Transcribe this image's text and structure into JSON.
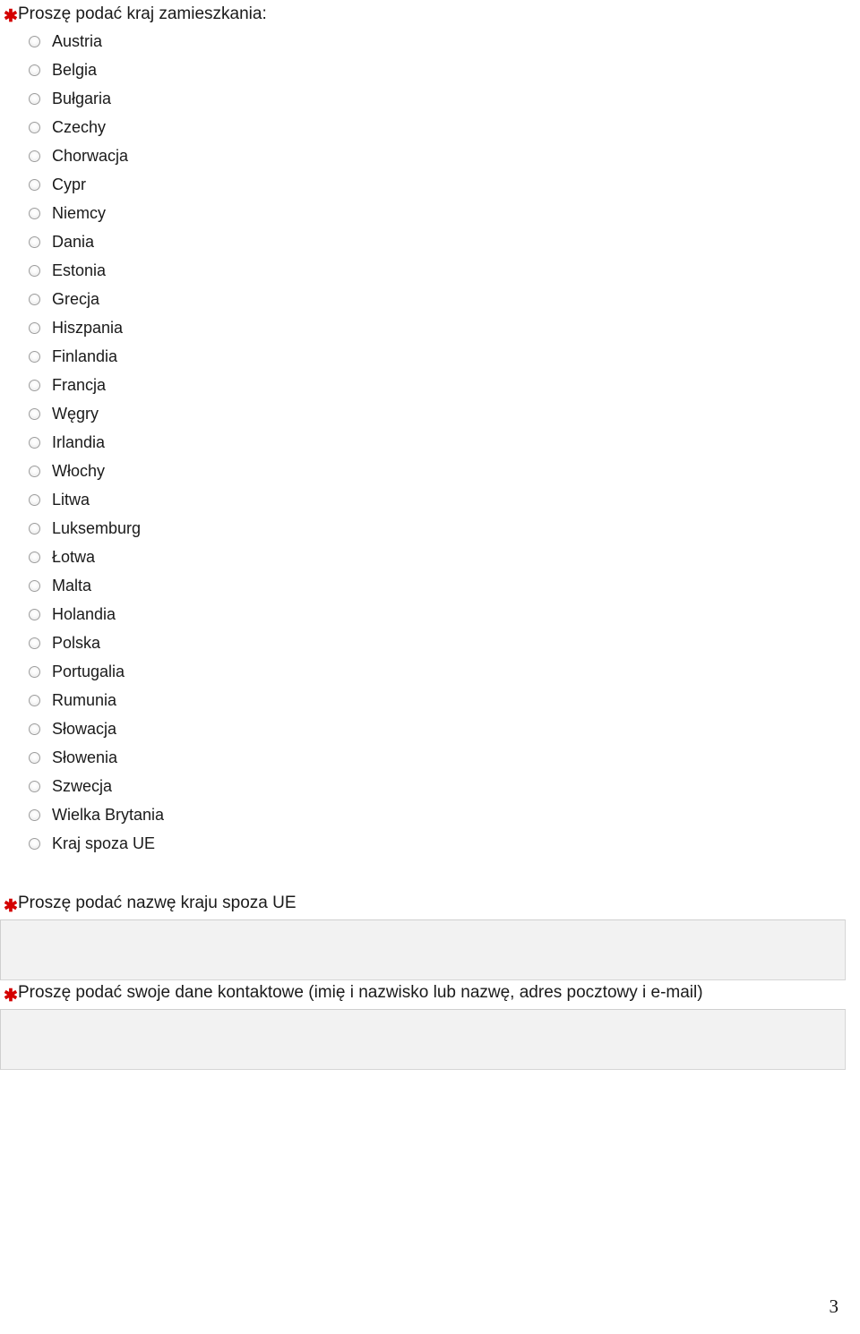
{
  "page": {
    "number": "3",
    "required_marker": "✱",
    "accent_required_color": "#d40000",
    "input_fill_color": "#f2f2f2",
    "input_border_color": "#d6d6d6"
  },
  "country_question": {
    "label": "Proszę podać kraj zamieszkania:",
    "required": true,
    "options": [
      {
        "label": "Austria",
        "selected": false
      },
      {
        "label": "Belgia",
        "selected": false
      },
      {
        "label": "Bułgaria",
        "selected": false
      },
      {
        "label": "Czechy",
        "selected": false
      },
      {
        "label": "Chorwacja",
        "selected": false
      },
      {
        "label": "Cypr",
        "selected": false
      },
      {
        "label": "Niemcy",
        "selected": false
      },
      {
        "label": "Dania",
        "selected": false
      },
      {
        "label": "Estonia",
        "selected": false
      },
      {
        "label": "Grecja",
        "selected": false
      },
      {
        "label": "Hiszpania",
        "selected": false
      },
      {
        "label": "Finlandia",
        "selected": false
      },
      {
        "label": "Francja",
        "selected": false
      },
      {
        "label": "Węgry",
        "selected": false
      },
      {
        "label": "Irlandia",
        "selected": false
      },
      {
        "label": "Włochy",
        "selected": false
      },
      {
        "label": "Litwa",
        "selected": false
      },
      {
        "label": "Luksemburg",
        "selected": false
      },
      {
        "label": "Łotwa",
        "selected": false
      },
      {
        "label": "Malta",
        "selected": false
      },
      {
        "label": "Holandia",
        "selected": false
      },
      {
        "label": "Polska",
        "selected": false
      },
      {
        "label": "Portugalia",
        "selected": false
      },
      {
        "label": "Rumunia",
        "selected": false
      },
      {
        "label": "Słowacja",
        "selected": false
      },
      {
        "label": "Słowenia",
        "selected": false
      },
      {
        "label": "Szwecja",
        "selected": false
      },
      {
        "label": "Wielka Brytania",
        "selected": false
      },
      {
        "label": "Kraj spoza UE",
        "selected": false
      }
    ]
  },
  "non_eu_country_question": {
    "label": "Proszę podać nazwę kraju spoza UE",
    "required": true,
    "value": "",
    "placeholder": ""
  },
  "contact_question": {
    "label": "Proszę podać swoje dane kontaktowe (imię i nazwisko lub nazwę, adres pocztowy i e-mail)",
    "required": true,
    "value": "",
    "placeholder": ""
  }
}
